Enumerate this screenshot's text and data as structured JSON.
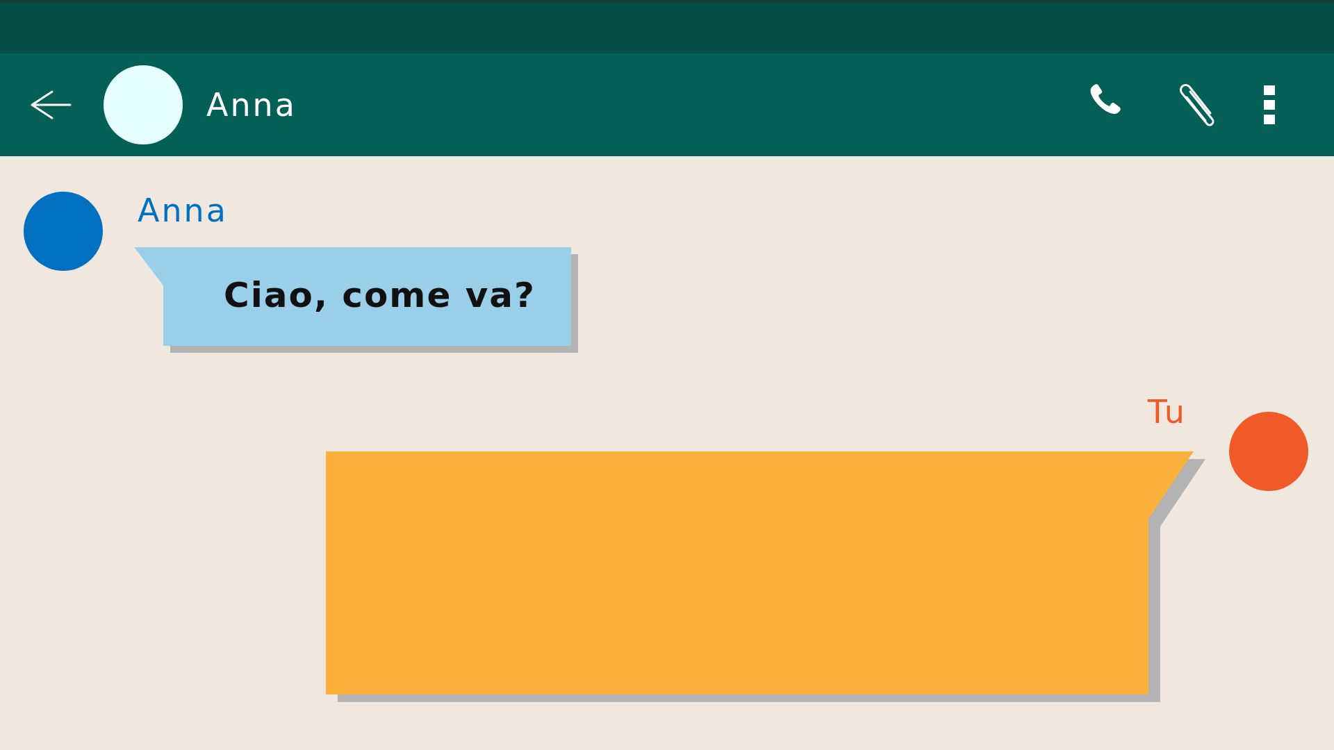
{
  "header": {
    "contact_name": "Anna"
  },
  "messages": [
    {
      "kind": "incoming",
      "sender": "Anna",
      "color": "#0070c0",
      "text": "Ciao, come va?"
    },
    {
      "kind": "outgoing",
      "sender": "Tu",
      "color": "#f05a28"
    }
  ]
}
